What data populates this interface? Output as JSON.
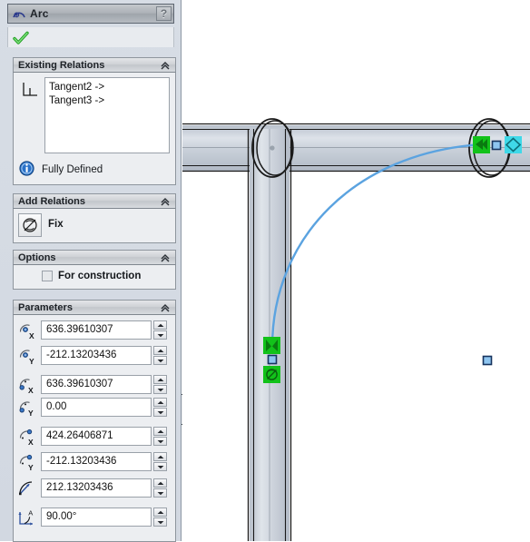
{
  "window": {
    "title": "Arc",
    "title_icon": "arc-icon",
    "help_label": "?",
    "ok_icon": "green-check-icon"
  },
  "panel": {
    "existing_relations": {
      "header": "Existing Relations",
      "collapse_icon": "chevron-up-icon",
      "relations_icon": "perpendicular-relation-icon",
      "items": [
        {
          "label": "Tangent2 ->"
        },
        {
          "label": "Tangent3 ->"
        }
      ],
      "status": {
        "icon": "info-icon",
        "label": "Fully Defined"
      }
    },
    "add_relations": {
      "header": "Add Relations",
      "collapse_icon": "chevron-up-icon",
      "fix_button": {
        "icon": "fix-relation-icon",
        "label": "Fix"
      }
    },
    "options": {
      "header": "Options",
      "collapse_icon": "chevron-up-icon",
      "for_construction": {
        "label": "For construction",
        "checked": false
      }
    },
    "parameters": {
      "header": "Parameters",
      "collapse_icon": "chevron-up-icon",
      "rows": [
        {
          "icon": "arc-center-x-icon",
          "param": "center_x",
          "value": "636.39610307"
        },
        {
          "icon": "arc-center-y-icon",
          "param": "center_y",
          "value": "-212.13203436"
        },
        {
          "icon": "arc-start-x-icon",
          "param": "start_x",
          "value": "636.39610307"
        },
        {
          "icon": "arc-start-y-icon",
          "param": "start_y",
          "value": "0.00"
        },
        {
          "icon": "arc-end-x-icon",
          "param": "end_x",
          "value": "424.26406871"
        },
        {
          "icon": "arc-end-y-icon",
          "param": "end_y",
          "value": "-212.13203436"
        },
        {
          "icon": "arc-radius-icon",
          "param": "radius",
          "value": "212.13203436"
        },
        {
          "icon": "arc-angle-icon",
          "param": "angle",
          "value": "90.00°"
        }
      ]
    },
    "splitter": {
      "icon": "collapse-panel-handle-icon"
    }
  },
  "viewport": {
    "name": "cad-graphics-area",
    "background": "#ffffff",
    "geometry": {
      "horizontal_tube_color": "#c5ccd6",
      "vertical_tube_color": "#c9d0d9",
      "sketch_arc_color": "#5ba3e0",
      "centerline_color": "#9aa3ad",
      "outline_color": "#1a1a1a"
    },
    "annotations": [
      {
        "name": "tangent-relation-marker-top-right",
        "icon": "green-tangent-arrows-icon",
        "color": "#12c21a"
      },
      {
        "name": "coincident-relation-marker",
        "icon": "cyan-coincident-icon",
        "color": "#3fd8e8"
      },
      {
        "name": "arc-endpoint-right",
        "icon": "sketch-point-icon",
        "color": "#8ec5f0"
      },
      {
        "name": "tangent-relation-marker-bottom",
        "icon": "green-tangent-arrows-icon",
        "color": "#12c21a"
      },
      {
        "name": "arc-endpoint-bottom",
        "icon": "sketch-point-icon",
        "color": "#8ec5f0"
      },
      {
        "name": "fix-relation-marker",
        "icon": "green-fix-icon",
        "color": "#12c21a"
      },
      {
        "name": "free-sketch-point",
        "icon": "sketch-point-icon",
        "color": "#8ec5f0"
      }
    ]
  }
}
